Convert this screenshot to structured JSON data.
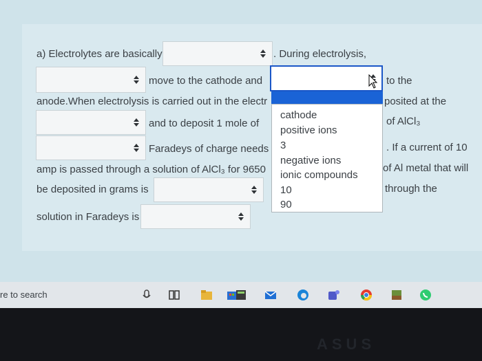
{
  "question": {
    "part_a_intro": "a) Electrolytes are basically",
    "during_electrolysis": ". During electrolysis,",
    "move_cathode": "move to the cathode and",
    "to_the": "to the",
    "anode_line": "anode.When electrolysis is carried out in the electr",
    "posited_at_the": "posited at the",
    "deposit_text": "and to deposit 1 mole of",
    "of_alcl3": "of AlCl₃",
    "faradeys_needs": "Faradeys of charge needs",
    "if_current": ". If a current of 10",
    "amp_passed": "amp is passed through a solution of AlCl₃ for 9650",
    "al_metal": "of Al metal that will",
    "deposited_grams": "be deposited in grams is",
    "through_the": "through the",
    "solution_faradeys": "solution in Faradeys is"
  },
  "dropdown": {
    "options": [
      "cathode",
      "positive ions",
      "3",
      "negative ions",
      "ionic compounds",
      "10",
      "90"
    ]
  },
  "taskbar": {
    "search_label": "re to search"
  },
  "brand": "ASUS"
}
